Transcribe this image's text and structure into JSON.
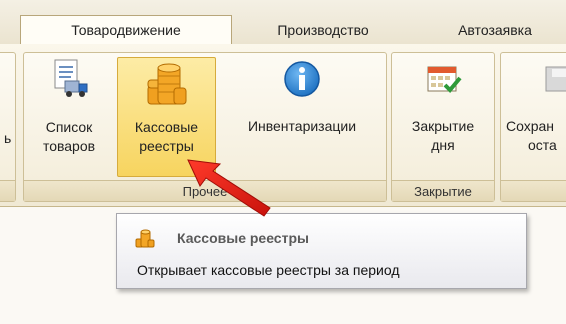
{
  "tabs": [
    {
      "label": "Товародвижение",
      "active": true
    },
    {
      "label": "Производство",
      "active": false
    },
    {
      "label": "Автозаявка",
      "active": false
    }
  ],
  "ribbon": {
    "left_partial_label": "ь",
    "buttons": [
      {
        "line1": "Список",
        "line2": "товаров",
        "icon": "document-truck-icon"
      },
      {
        "line1": "Кассовые",
        "line2": "реестры",
        "icon": "coins-stack-icon",
        "hovered": true
      },
      {
        "line1": "Инвентаризации",
        "line2": "",
        "icon": "info-icon"
      },
      {
        "line1": "Закрытие",
        "line2": "дня",
        "icon": "calendar-check-icon"
      },
      {
        "line1": "Сохран",
        "line2": "оста",
        "icon": "save-icon"
      }
    ],
    "groups": [
      "Прочее",
      "Закрытие"
    ]
  },
  "tooltip": {
    "title": "Кассовые реестры",
    "description": "Открывает кассовые реестры за период",
    "icon": "coins-stack-icon"
  },
  "colors": {
    "accent_highlight": "#f7d45f",
    "info_blue": "#1b7fd1",
    "arrow_red": "#e0201a"
  }
}
